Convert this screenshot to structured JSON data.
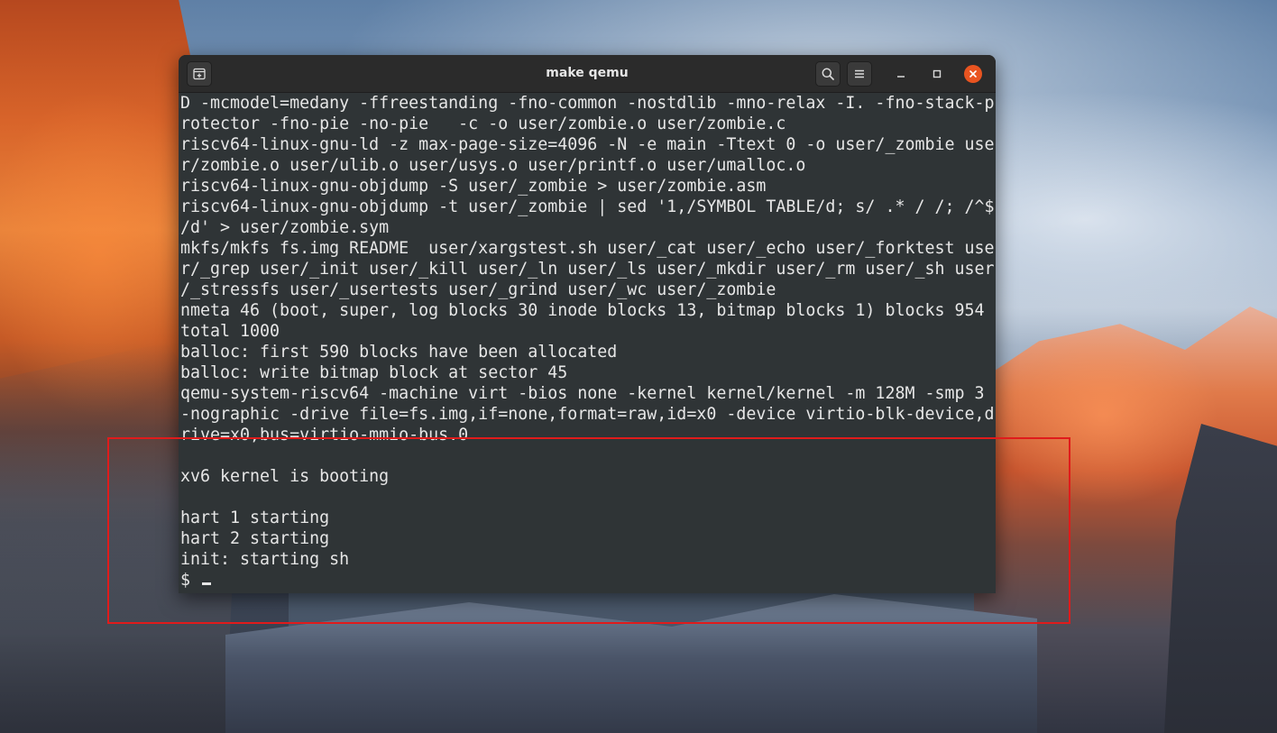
{
  "window": {
    "title": "make qemu",
    "colors": {
      "titlebar": "#2b2b2b",
      "terminal_bg": "#2f3436",
      "text": "#e6e6e6",
      "close_accent": "#e95420",
      "annotation": "#e01b1b"
    },
    "icons": {
      "new_tab": "new-tab-icon",
      "search": "search-icon",
      "menu": "hamburger-menu-icon",
      "minimize": "minimize-icon",
      "maximize": "maximize-icon",
      "close": "close-icon"
    }
  },
  "terminal": {
    "lines": [
      "D -mcmodel=medany -ffreestanding -fno-common -nostdlib -mno-relax -I. -fno-stack-p",
      "rotector -fno-pie -no-pie   -c -o user/zombie.o user/zombie.c",
      "riscv64-linux-gnu-ld -z max-page-size=4096 -N -e main -Ttext 0 -o user/_zombie use",
      "r/zombie.o user/ulib.o user/usys.o user/printf.o user/umalloc.o",
      "riscv64-linux-gnu-objdump -S user/_zombie > user/zombie.asm",
      "riscv64-linux-gnu-objdump -t user/_zombie | sed '1,/SYMBOL TABLE/d; s/ .* / /; /^$",
      "/d' > user/zombie.sym",
      "mkfs/mkfs fs.img README  user/xargstest.sh user/_cat user/_echo user/_forktest use",
      "r/_grep user/_init user/_kill user/_ln user/_ls user/_mkdir user/_rm user/_sh user",
      "/_stressfs user/_usertests user/_grind user/_wc user/_zombie",
      "nmeta 46 (boot, super, log blocks 30 inode blocks 13, bitmap blocks 1) blocks 954",
      "total 1000",
      "balloc: first 590 blocks have been allocated",
      "balloc: write bitmap block at sector 45",
      "qemu-system-riscv64 -machine virt -bios none -kernel kernel/kernel -m 128M -smp 3",
      "-nographic -drive file=fs.img,if=none,format=raw,id=x0 -device virtio-blk-device,d",
      "rive=x0,bus=virtio-mmio-bus.0",
      "",
      "xv6 kernel is booting",
      "",
      "hart 1 starting",
      "hart 2 starting",
      "init: starting sh"
    ],
    "prompt": "$ "
  }
}
